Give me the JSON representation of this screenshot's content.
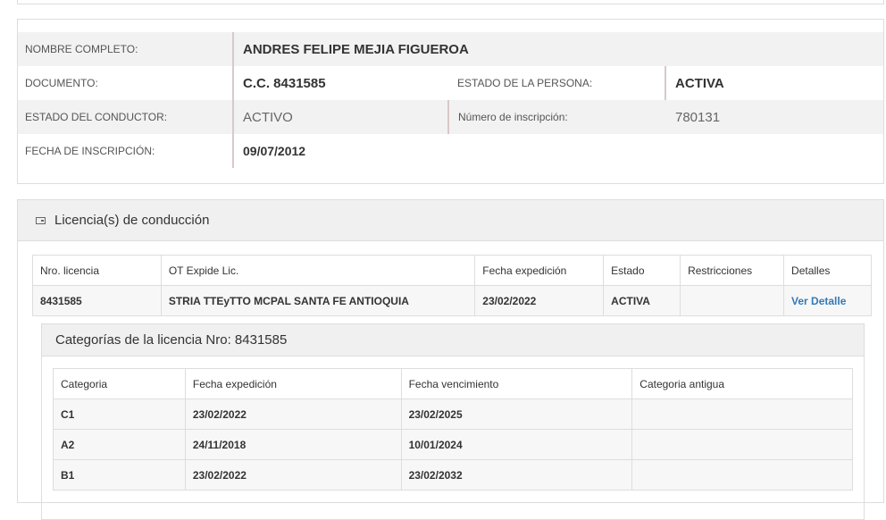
{
  "person": {
    "nombre_label": "NOMBRE COMPLETO:",
    "nombre": "ANDRES FELIPE MEJIA FIGUEROA",
    "documento_label": "DOCUMENTO:",
    "documento": "C.C. 8431585",
    "estado_persona_label": "ESTADO DE LA PERSONA:",
    "estado_persona": "ACTIVA",
    "estado_conductor_label": "ESTADO DEL CONDUCTOR:",
    "estado_conductor": "ACTIVO",
    "num_inscripcion_label": "Número de inscripción:",
    "num_inscripcion": "780131",
    "fecha_inscripcion_label": "FECHA DE INSCRIPCIÓN:",
    "fecha_inscripcion": "09/07/2012"
  },
  "licencias": {
    "title": "Licencia(s) de conducción",
    "icon": "id-card-icon",
    "columns": [
      "Nro. licencia",
      "OT Expide Lic.",
      "Fecha expedición",
      "Estado",
      "Restricciones",
      "Detalles"
    ],
    "rows": [
      [
        "8431585",
        "STRIA TTEyTTO MCPAL SANTA FE ANTIOQUIA",
        "23/02/2022",
        "ACTIVA",
        "",
        "Ver Detalle"
      ]
    ]
  },
  "categorias": {
    "title": "Categorías de la licencia Nro: 8431585",
    "columns": [
      "Categoria",
      "Fecha expedición",
      "Fecha vencimiento",
      "Categoria antigua"
    ],
    "rows": [
      [
        "C1",
        "23/02/2022",
        "23/02/2025",
        ""
      ],
      [
        "A2",
        "24/11/2018",
        "10/01/2024",
        ""
      ],
      [
        "B1",
        "23/02/2022",
        "23/02/2032",
        ""
      ]
    ]
  },
  "colors": {
    "link": "#337ab7",
    "panel_header": "#f0f0f0",
    "row_shade": "#f2f2f2"
  }
}
